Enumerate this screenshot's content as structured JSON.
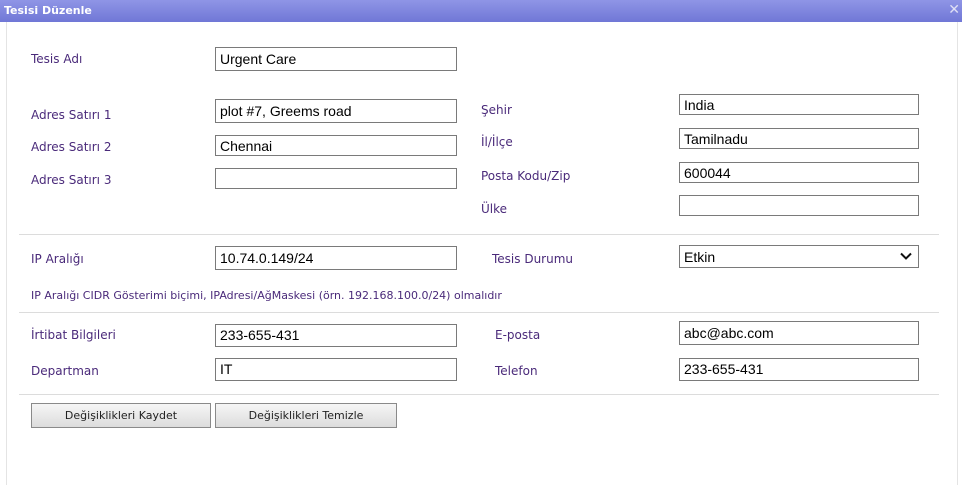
{
  "title": "Tesisi Düzenle",
  "close_glyph": "✕",
  "facility_name": {
    "label": "Tesis Adı",
    "value": "Urgent Care"
  },
  "address1": {
    "label": "Adres Satırı 1",
    "value": "plot #7, Greems road"
  },
  "address2": {
    "label": "Adres Satırı 2",
    "value": "Chennai"
  },
  "address3": {
    "label": "Adres Satırı 3",
    "value": ""
  },
  "city": {
    "label": "Şehir",
    "value": "India"
  },
  "district": {
    "label": "İl/İlçe",
    "value": "Tamilnadu"
  },
  "postal": {
    "label": "Posta Kodu/Zip",
    "value": "600044"
  },
  "country": {
    "label": "Ülke",
    "value": ""
  },
  "ip_range": {
    "label": "IP Aralığı",
    "value": "10.74.0.149/24"
  },
  "status": {
    "label": "Tesis Durumu",
    "value": "Etkin"
  },
  "ip_note": "IP Aralığı CIDR Gösterimi biçimi, IPAdresi/AğMaskesi (örn. 192.168.100.0/24) olmalıdır",
  "contact": {
    "label": "İrtibat Bilgileri",
    "value": "233-655-431"
  },
  "department": {
    "label": "Departman",
    "value": "IT"
  },
  "email": {
    "label": "E-posta",
    "value": "abc@abc.com"
  },
  "phone": {
    "label": "Telefon",
    "value": "233-655-431"
  },
  "buttons": {
    "save": "Değişiklikleri Kaydet",
    "clear": "Değişiklikleri Temizle"
  }
}
